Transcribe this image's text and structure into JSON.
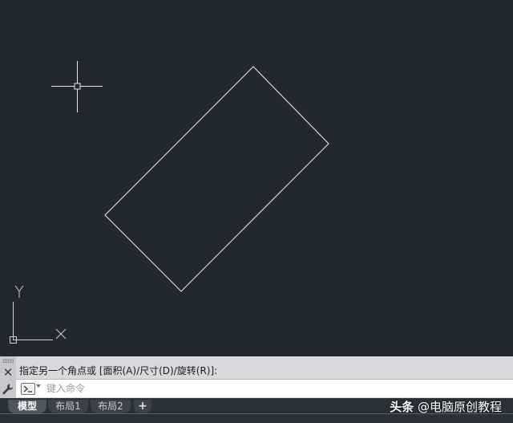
{
  "drawing": {
    "background": "#212830",
    "stroke_color": "#e6e6e6",
    "ucs_y_label": "Y",
    "ucs_x_label": "X"
  },
  "command_line": {
    "history_line": "指定另一个角点或 [面积(A)/尺寸(D)/旋转(R)]:",
    "input_placeholder": "键入命令",
    "input_value": ""
  },
  "tabs": [
    {
      "label": "模型",
      "active": true
    },
    {
      "label": "布局1",
      "active": false
    },
    {
      "label": "布局2",
      "active": false
    },
    {
      "label": "+",
      "active": false
    }
  ],
  "watermark": {
    "brand": "头条",
    "account": "@电脑原创教程"
  },
  "icons": {
    "close": "close-icon",
    "customize": "wrench-icon",
    "prompt": "command-prompt-icon",
    "crosshair": "crosshair-cursor-icon",
    "ucs": "ucs-axis-icon"
  }
}
